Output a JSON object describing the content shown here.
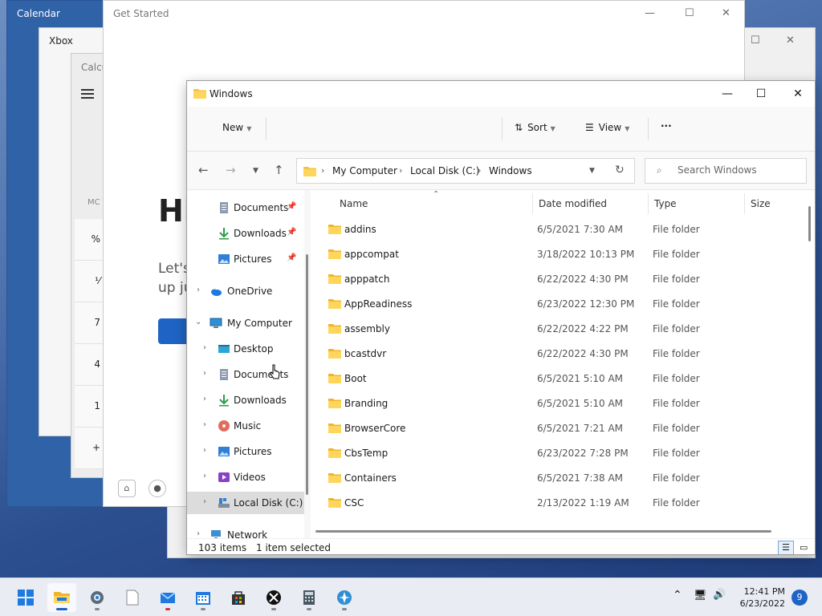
{
  "windows": {
    "calendar_title": "Calendar",
    "xbox_title": "Xbox",
    "calculator_title": "Calcu",
    "calculator_memory_label": "MC",
    "get_started_title": "Get Started",
    "get_started_heading": "Hi",
    "get_started_text_line1": "Let's",
    "get_started_text_line2": "up ju"
  },
  "explorer": {
    "title": "Windows",
    "toolbar": {
      "new_label": "New",
      "sort_label": "Sort",
      "view_label": "View",
      "more_label": "···"
    },
    "address": {
      "segments": [
        "My Computer",
        "Local Disk (C:)",
        "Windows"
      ]
    },
    "search": {
      "placeholder": "Search Windows"
    },
    "sidebar": {
      "items": [
        {
          "label": "Documents",
          "icon": "documents-icon",
          "pinned": true
        },
        {
          "label": "Downloads",
          "icon": "downloads-icon",
          "pinned": true
        },
        {
          "label": "Pictures",
          "icon": "pictures-icon",
          "pinned": true
        },
        {
          "label": "OneDrive",
          "icon": "onedrive-icon"
        },
        {
          "label": "My Computer",
          "icon": "computer-icon"
        },
        {
          "label": "Desktop",
          "icon": "desktop-icon"
        },
        {
          "label": "Documents",
          "icon": "documents-icon"
        },
        {
          "label": "Downloads",
          "icon": "downloads-icon"
        },
        {
          "label": "Music",
          "icon": "music-icon"
        },
        {
          "label": "Pictures",
          "icon": "pictures-icon"
        },
        {
          "label": "Videos",
          "icon": "videos-icon"
        },
        {
          "label": "Local Disk (C:)",
          "icon": "drive-icon"
        },
        {
          "label": "Network",
          "icon": "network-icon"
        }
      ]
    },
    "columns": {
      "name": "Name",
      "date": "Date modified",
      "type": "Type",
      "size": "Size"
    },
    "rows": [
      {
        "name": "addins",
        "date": "6/5/2021 7:30 AM",
        "type": "File folder"
      },
      {
        "name": "appcompat",
        "date": "3/18/2022 10:13 PM",
        "type": "File folder"
      },
      {
        "name": "apppatch",
        "date": "6/22/2022 4:30 PM",
        "type": "File folder"
      },
      {
        "name": "AppReadiness",
        "date": "6/23/2022 12:30 PM",
        "type": "File folder"
      },
      {
        "name": "assembly",
        "date": "6/22/2022 4:22 PM",
        "type": "File folder"
      },
      {
        "name": "bcastdvr",
        "date": "6/22/2022 4:30 PM",
        "type": "File folder"
      },
      {
        "name": "Boot",
        "date": "6/5/2021 5:10 AM",
        "type": "File folder"
      },
      {
        "name": "Branding",
        "date": "6/5/2021 5:10 AM",
        "type": "File folder"
      },
      {
        "name": "BrowserCore",
        "date": "6/5/2021 7:21 AM",
        "type": "File folder"
      },
      {
        "name": "CbsTemp",
        "date": "6/23/2022 7:28 PM",
        "type": "File folder"
      },
      {
        "name": "Containers",
        "date": "6/5/2021 7:38 AM",
        "type": "File folder"
      },
      {
        "name": "CSC",
        "date": "2/13/2022 1:19 AM",
        "type": "File folder"
      }
    ],
    "status": {
      "items_count": "103 items",
      "selection": "1 item selected"
    }
  },
  "taskbar": {
    "apps": [
      "start-icon",
      "file-explorer-icon",
      "settings-icon",
      "notepad-icon",
      "mail-icon",
      "calendar-icon",
      "store-icon",
      "xbox-icon",
      "calculator-icon",
      "get-started-icon"
    ],
    "time": "12:41 PM",
    "date": "6/23/2022",
    "notification_count": "9"
  },
  "colors": {
    "accent": "#1f63c4",
    "folder": "#f5c342",
    "taskbar": "#e9edf3"
  }
}
